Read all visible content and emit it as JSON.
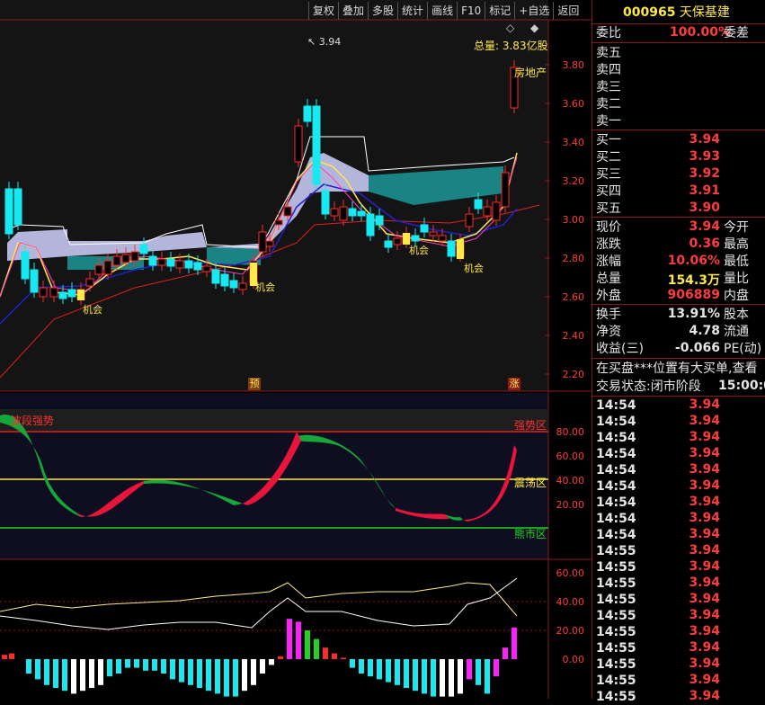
{
  "toolbar": {
    "buttons": [
      "复权",
      "叠加",
      "多股",
      "统计",
      "画线",
      "F10",
      "标记",
      "+自选",
      "返回"
    ]
  },
  "main": {
    "high_marker": "3.94",
    "volume_label": "总量: 3.83亿股",
    "sector_label": "房地产",
    "signal_label": "机会",
    "price_ticks": [
      "3.80",
      "3.60",
      "3.40",
      "3.20",
      "3.00",
      "2.80",
      "2.60",
      "2.40",
      "2.20"
    ],
    "bottom_marks": [
      "预",
      "涨"
    ]
  },
  "indicator1": {
    "title": "波段强势",
    "strong_label": "强势区",
    "shock_label": "震荡区",
    "bear_label": "熊市区",
    "ticks": [
      "80.00",
      "60.00",
      "40.00",
      "20.00"
    ]
  },
  "indicator2": {
    "ticks": [
      "60.00",
      "40.00",
      "20.00",
      "0.00"
    ]
  },
  "panel": {
    "code": "000965",
    "name": "天保基建",
    "weibi_label": "委比",
    "weibi_value": "100.00%",
    "weicha_label": "委差",
    "sells": [
      {
        "label": "卖五",
        "price": "",
        "vol": ""
      },
      {
        "label": "卖四",
        "price": "",
        "vol": ""
      },
      {
        "label": "卖三",
        "price": "",
        "vol": ""
      },
      {
        "label": "卖二",
        "price": "",
        "vol": ""
      },
      {
        "label": "卖一",
        "price": "",
        "vol": ""
      }
    ],
    "buys": [
      {
        "label": "买一",
        "price": "3.94"
      },
      {
        "label": "买二",
        "price": "3.93"
      },
      {
        "label": "买三",
        "price": "3.92"
      },
      {
        "label": "买四",
        "price": "3.91"
      },
      {
        "label": "买五",
        "price": "3.90"
      }
    ],
    "quote": [
      {
        "l": "现价",
        "v": "3.94",
        "r": "今开",
        "c": "red"
      },
      {
        "l": "涨跌",
        "v": "0.36",
        "r": "最高",
        "c": "red"
      },
      {
        "l": "涨幅",
        "v": "10.06%",
        "r": "最低",
        "c": "red"
      },
      {
        "l": "总量",
        "v": "154.3万",
        "r": "量比",
        "c": "yel"
      },
      {
        "l": "外盘",
        "v": "906889",
        "r": "内盘",
        "c": "red"
      }
    ],
    "fundamentals": [
      {
        "l": "换手",
        "v": "13.91%",
        "r": "股本"
      },
      {
        "l": "净资",
        "v": "4.78",
        "r": "流通"
      },
      {
        "l": "收益(三)",
        "v": "-0.066",
        "r": "PE(动)"
      }
    ],
    "notice": "在买盘***位置有大买单,查看",
    "status_label": "交易状态:",
    "status_value": "闭市阶段",
    "status_time": "15:00:0",
    "ticks": [
      {
        "t": "14:54",
        "p": "3.94"
      },
      {
        "t": "14:54",
        "p": "3.94"
      },
      {
        "t": "14:54",
        "p": "3.94"
      },
      {
        "t": "14:54",
        "p": "3.94"
      },
      {
        "t": "14:54",
        "p": "3.94"
      },
      {
        "t": "14:54",
        "p": "3.94"
      },
      {
        "t": "14:54",
        "p": "3.94"
      },
      {
        "t": "14:54",
        "p": "3.94"
      },
      {
        "t": "14:54",
        "p": "3.94"
      },
      {
        "t": "14:55",
        "p": "3.94"
      },
      {
        "t": "14:55",
        "p": "3.94"
      },
      {
        "t": "14:55",
        "p": "3.94"
      },
      {
        "t": "14:55",
        "p": "3.94"
      },
      {
        "t": "14:55",
        "p": "3.94"
      },
      {
        "t": "14:55",
        "p": "3.94"
      },
      {
        "t": "14:55",
        "p": "3.94"
      },
      {
        "t": "14:55",
        "p": "3.94"
      },
      {
        "t": "14:55",
        "p": "3.94"
      },
      {
        "t": "14:55",
        "p": "3.94"
      }
    ]
  },
  "colors": {
    "up": "#ff2a2a",
    "down": "#18e8f0",
    "grid": "#8a1a1a",
    "yellow": "#ffe84a",
    "green": "#1aa31a",
    "crimson": "#e8143c",
    "teal": "#1a8a8a",
    "lavender": "#c4c6f0"
  }
}
